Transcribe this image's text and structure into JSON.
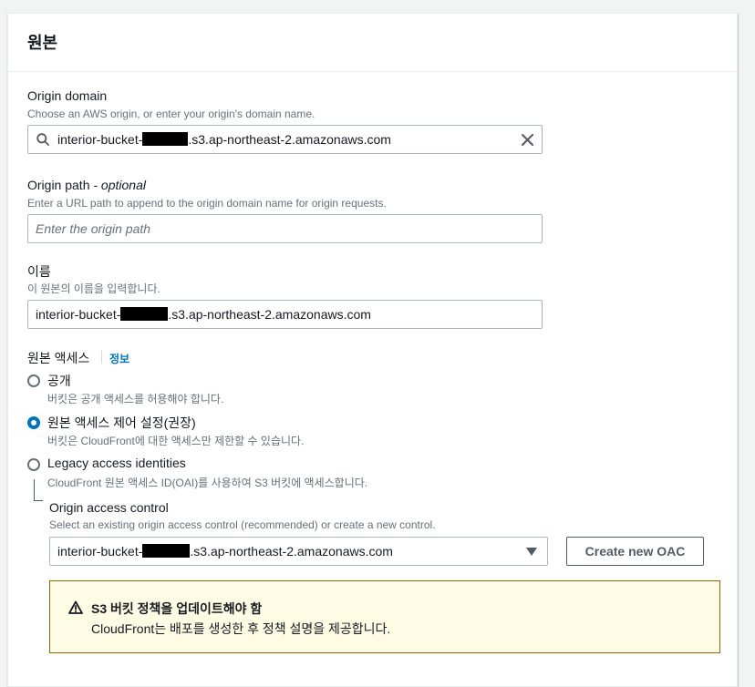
{
  "panel": {
    "title": "원본"
  },
  "origin_domain": {
    "label": "Origin domain",
    "description": "Choose an AWS origin, or enter your origin's domain name.",
    "value_prefix": "interior-bucket-",
    "value_suffix": ".s3.ap-northeast-2.amazonaws.com"
  },
  "origin_path": {
    "label": "Origin path",
    "optional": "- optional",
    "description": "Enter a URL path to append to the origin domain name for origin requests.",
    "placeholder": "Enter the origin path"
  },
  "name": {
    "label": "이름",
    "description": "이 원본의 이름을 입력합니다.",
    "value_prefix": "interior-bucket-",
    "value_suffix": ".s3.ap-northeast-2.amazonaws.com"
  },
  "origin_access": {
    "label": "원본 액세스",
    "info_link": "정보",
    "options": [
      {
        "label": "공개",
        "description": "버킷은 공개 액세스를 허용해야 합니다.",
        "selected": false
      },
      {
        "label": "원본 액세스 제어 설정(권장)",
        "description": "버킷은 CloudFront에 대한 액세스만 제한할 수 있습니다.",
        "selected": true
      },
      {
        "label": "Legacy access identities",
        "description": "CloudFront 원본 액세스 ID(OAI)를 사용하여 S3 버킷에 액세스합니다.",
        "selected": false
      }
    ]
  },
  "oac": {
    "label": "Origin access control",
    "description": "Select an existing origin access control (recommended) or create a new control.",
    "value_prefix": "interior-bucket-",
    "value_suffix": ".s3.ap-northeast-2.amazonaws.com",
    "create_button": "Create new OAC"
  },
  "warning": {
    "title": "S3 버킷 정책을 업데이트해야 함",
    "message": "CloudFront는 배포를 생성한 후 정책 설명을 제공합니다."
  },
  "colors": {
    "accent": "#0073bb",
    "warning_border": "#8d6605",
    "warning_bg": "#fffce6"
  }
}
